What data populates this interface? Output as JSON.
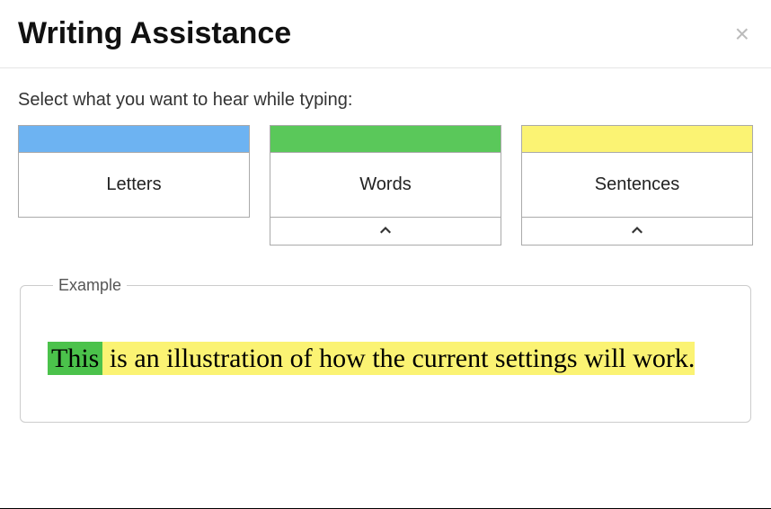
{
  "header": {
    "title": "Writing Assistance",
    "close_label": "×"
  },
  "instruction": "Select what you want to hear while typing:",
  "options": {
    "letters": {
      "label": "Letters"
    },
    "words": {
      "label": "Words"
    },
    "sentences": {
      "label": "Sentences"
    }
  },
  "example": {
    "legend": "Example",
    "word": "This",
    "rest": " is an illustration of how the current settings will work."
  },
  "colors": {
    "letters": "#6db3f2",
    "words": "#5ac85a",
    "sentences": "#fbf373"
  }
}
